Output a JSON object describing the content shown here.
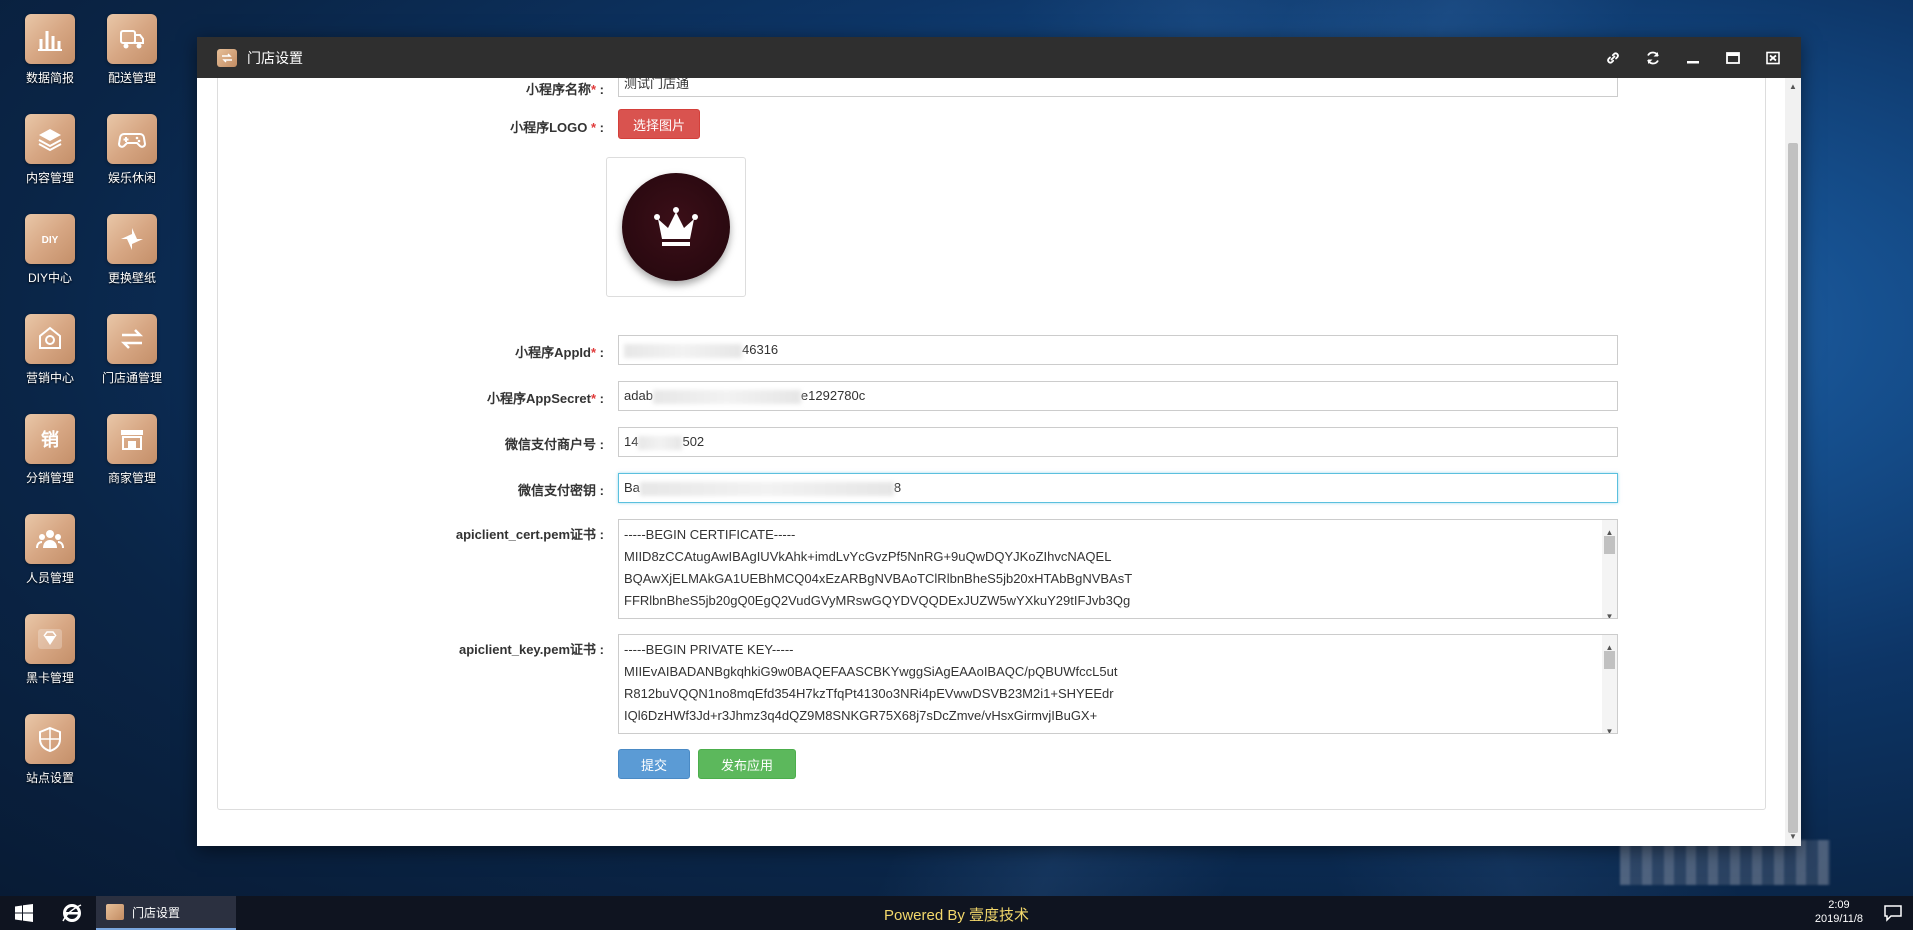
{
  "desktop": {
    "icons": [
      {
        "label": "数据简报",
        "icon": "bar-chart-icon"
      },
      {
        "label": "配送管理",
        "icon": "delivery-truck-icon"
      },
      {
        "label": "内容管理",
        "icon": "layers-icon"
      },
      {
        "label": "娱乐休闲",
        "icon": "gamepad-icon"
      },
      {
        "label": "DIY中心",
        "icon": "diy-icon"
      },
      {
        "label": "更换壁纸",
        "icon": "pinwheel-icon"
      },
      {
        "label": "营销中心",
        "icon": "tag-icon"
      },
      {
        "label": "门店通管理",
        "icon": "swap-arrows-icon"
      },
      {
        "label": "分销管理",
        "icon": "sale-icon"
      },
      {
        "label": "商家管理",
        "icon": "storefront-icon"
      },
      {
        "label": "人员管理",
        "icon": "users-icon"
      },
      {
        "label": "黑卡管理",
        "icon": "diamond-card-icon"
      },
      {
        "label": "站点设置",
        "icon": "shield-icon"
      }
    ]
  },
  "window": {
    "title": "门店设置",
    "controls": [
      "link-icon",
      "refresh-icon",
      "minimize-icon",
      "maximize-icon",
      "close-icon"
    ]
  },
  "form": {
    "app_name": {
      "label": "小程序名称",
      "required_mark": "*",
      "value": "测试门店通"
    },
    "app_logo": {
      "label": "小程序LOGO",
      "required_mark": "*",
      "button": "选择图片"
    },
    "app_id": {
      "label": "小程序AppId",
      "required_mark": "*",
      "value_visible_prefix": "",
      "value_visible_suffix": "46316"
    },
    "app_secret": {
      "label": "小程序AppSecret",
      "required_mark": "*",
      "value_visible_prefix": "adab",
      "value_visible_suffix": "e1292780c"
    },
    "merchant_id": {
      "label": "微信支付商户号",
      "value_visible_prefix": "14",
      "value_visible_suffix": "502"
    },
    "pay_key": {
      "label": "微信支付密钥",
      "value_visible_prefix": "Ba",
      "value_visible_suffix": "8"
    },
    "cert_pem": {
      "label": "apiclient_cert.pem证书",
      "lines": [
        "-----BEGIN CERTIFICATE-----",
        "MIID8zCCAtugAwIBAgIUVkAhk+imdLvYcGvzPf5NnRG+9uQwDQYJKoZIhvcNAQEL",
        "BQAwXjELMAkGA1UEBhMCQ04xEzARBgNVBAoTClRlbnBheS5jb20xHTAbBgNVBAsT",
        "FFRlbnBheS5jb20gQ0EgQ2VudGVyMRswGQYDVQQDExJUZW5wYXkuY29tIFJvb3Qg"
      ]
    },
    "key_pem": {
      "label": "apiclient_key.pem证书",
      "lines": [
        "-----BEGIN PRIVATE KEY-----",
        "MIIEvAIBADANBgkqhkiG9w0BAQEFAASCBKYwggSiAgEAAoIBAQC/pQBUWfccL5ut",
        "R812buVQQN1no8mqEfd354H7kzTfqPt4130o3NRi4pEVwwDSVB23M2i1+SHYEEdr",
        "IQl6DzHWf3Jd+r3Jhmz3q4dQZ9M8SNKGR75X68j7sDcZmve/vHsxGirmvjIBuGX+"
      ]
    },
    "submit_label": "提交",
    "publish_label": "发布应用"
  },
  "taskbar": {
    "app_label": "门店设置",
    "powered_by": "Powered By 壹度技术",
    "time": "2:09",
    "date": "2019/11/8"
  }
}
